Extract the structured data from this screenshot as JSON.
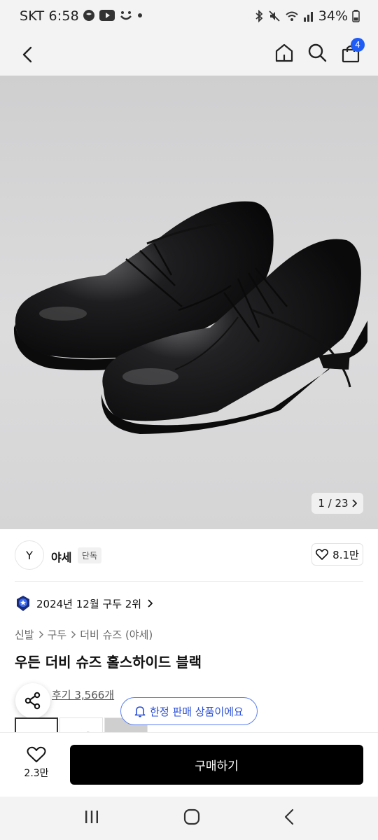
{
  "status_bar": {
    "carrier_time": "SKT 6:58",
    "battery": "34%",
    "icons": [
      "whatsapp-icon",
      "youtube-icon",
      "chat-smile-icon",
      "dot-icon",
      "bluetooth-icon",
      "mute-icon",
      "wifi-icon",
      "signal-icon",
      "battery-icon"
    ]
  },
  "header": {
    "back_icon": "chevron-left-icon",
    "home_icon": "home-icon",
    "search_icon": "search-icon",
    "cart_icon": "shopping-bag-icon",
    "cart_count": "4"
  },
  "gallery": {
    "counter": "1 / 23",
    "counter_icon": "chevron-right-icon"
  },
  "brand": {
    "logo_text": "Y",
    "name": "야세",
    "tag": "단독",
    "like_count": "8.1만"
  },
  "ranking": {
    "text": "2024년 12월 구두 2위"
  },
  "breadcrumb": [
    "신발",
    "구두",
    "더비 슈즈 (야세)"
  ],
  "product": {
    "title": "우든 더비 슈즈 홀스하이드 블랙",
    "reviews": "후기 3,566개"
  },
  "toast": {
    "text": "한정 판매 상품이에요"
  },
  "bottom": {
    "wish_count": "2.3만",
    "buy_label": "구매하기"
  },
  "colors": {
    "accent": "#1e5cf5",
    "toast_text": "#2a4fd8",
    "buy_bg": "#000000"
  }
}
